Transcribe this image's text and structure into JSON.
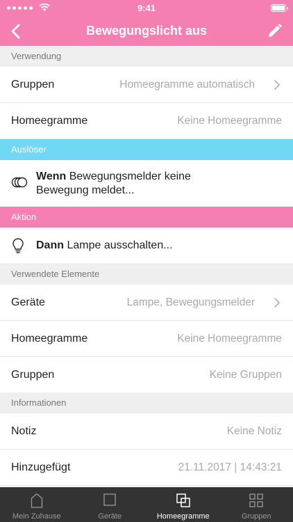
{
  "status": {
    "time": "9:41"
  },
  "nav": {
    "title": "Bewegungslicht aus"
  },
  "sections": {
    "verwendung": "Verwendung",
    "ausloeser": "Auslöser",
    "aktion": "Aktion",
    "elemente": "Verwendete Elemente",
    "informationen": "Informationen"
  },
  "verwendung": {
    "gruppen": {
      "label": "Gruppen",
      "value": "Homeegramme automatisch"
    },
    "homeegramme": {
      "label": "Homeegramme",
      "value": "Keine Homeegramme"
    }
  },
  "trigger": {
    "keyword": "Wenn",
    "line1": "Bewegungsmelder keine",
    "line2": "Bewegung meldet..."
  },
  "action": {
    "keyword": "Dann",
    "text": "Lampe ausschalten..."
  },
  "elemente": {
    "geraete": {
      "label": "Geräte",
      "value": "Lampe, Bewegungsmelder"
    },
    "homeegramme": {
      "label": "Homeegramme",
      "value": "Keine Homeegramme"
    },
    "gruppen": {
      "label": "Gruppen",
      "value": "Keine Gruppen"
    }
  },
  "info": {
    "notiz": {
      "label": "Notiz",
      "value": "Keine Notiz"
    },
    "hinzugefuegt": {
      "label": "Hinzugefügt",
      "value": "21.11.2017 | 14:43:21"
    }
  },
  "tabs": [
    {
      "label": "Mein Zuhause",
      "icon": "house-icon",
      "active": false
    },
    {
      "label": "Geräte",
      "icon": "square-icon",
      "active": false
    },
    {
      "label": "Homeegramme",
      "icon": "overlapping-squares-icon",
      "active": true
    },
    {
      "label": "Gruppen",
      "icon": "grid-icon",
      "active": false
    }
  ],
  "colors": {
    "pink": "#f47fb0",
    "blue": "#6fd8f3",
    "tabbar": "#333333"
  }
}
